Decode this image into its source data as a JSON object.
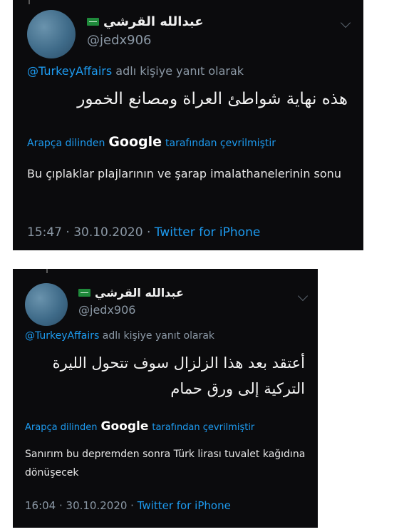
{
  "tweets": [
    {
      "display_name": "عبدالله القرشي",
      "handle": "@jedx906",
      "reply_mention": "@TurkeyAffairs",
      "reply_suffix": "adlı kişiye yanıt olarak",
      "text_arabic": "هذه نهاية شواطئ العراة ومصانع الخمور",
      "translated_prefix": "Arapça dilinden",
      "translated_brand": "Google",
      "translated_suffix": "tarafından çevrilmiştir",
      "translation": "Bu çıplaklar plajlarının ve şarap imalathanelerinin sonu",
      "time_date": "15:47 · 30.10.2020 ·",
      "client": "Twitter for iPhone"
    },
    {
      "display_name": "عبدالله القرشي",
      "handle": "@jedx906",
      "reply_mention": "@TurkeyAffairs",
      "reply_suffix": "adlı kişiye yanıt olarak",
      "text_arabic": "أعتقد بعد هذا الزلزال سوف تتحول الليرة التركية إلى ورق حمام",
      "translated_prefix": "Arapça dilinden",
      "translated_brand": "Google",
      "translated_suffix": "tarafından çevrilmiştir",
      "translation": "Sanırım bu depremden sonra Türk lirası tuvalet kağıdına dönüşecek",
      "time_date": "16:04 · 30.10.2020 ·",
      "client": "Twitter for iPhone"
    }
  ],
  "icons": {
    "flag": "saudi-flag-emoji",
    "menu": "chevron-down-icon"
  },
  "colors": {
    "background": "#0b0b0d",
    "link": "#1d9bf0",
    "muted": "#8b98a5"
  }
}
